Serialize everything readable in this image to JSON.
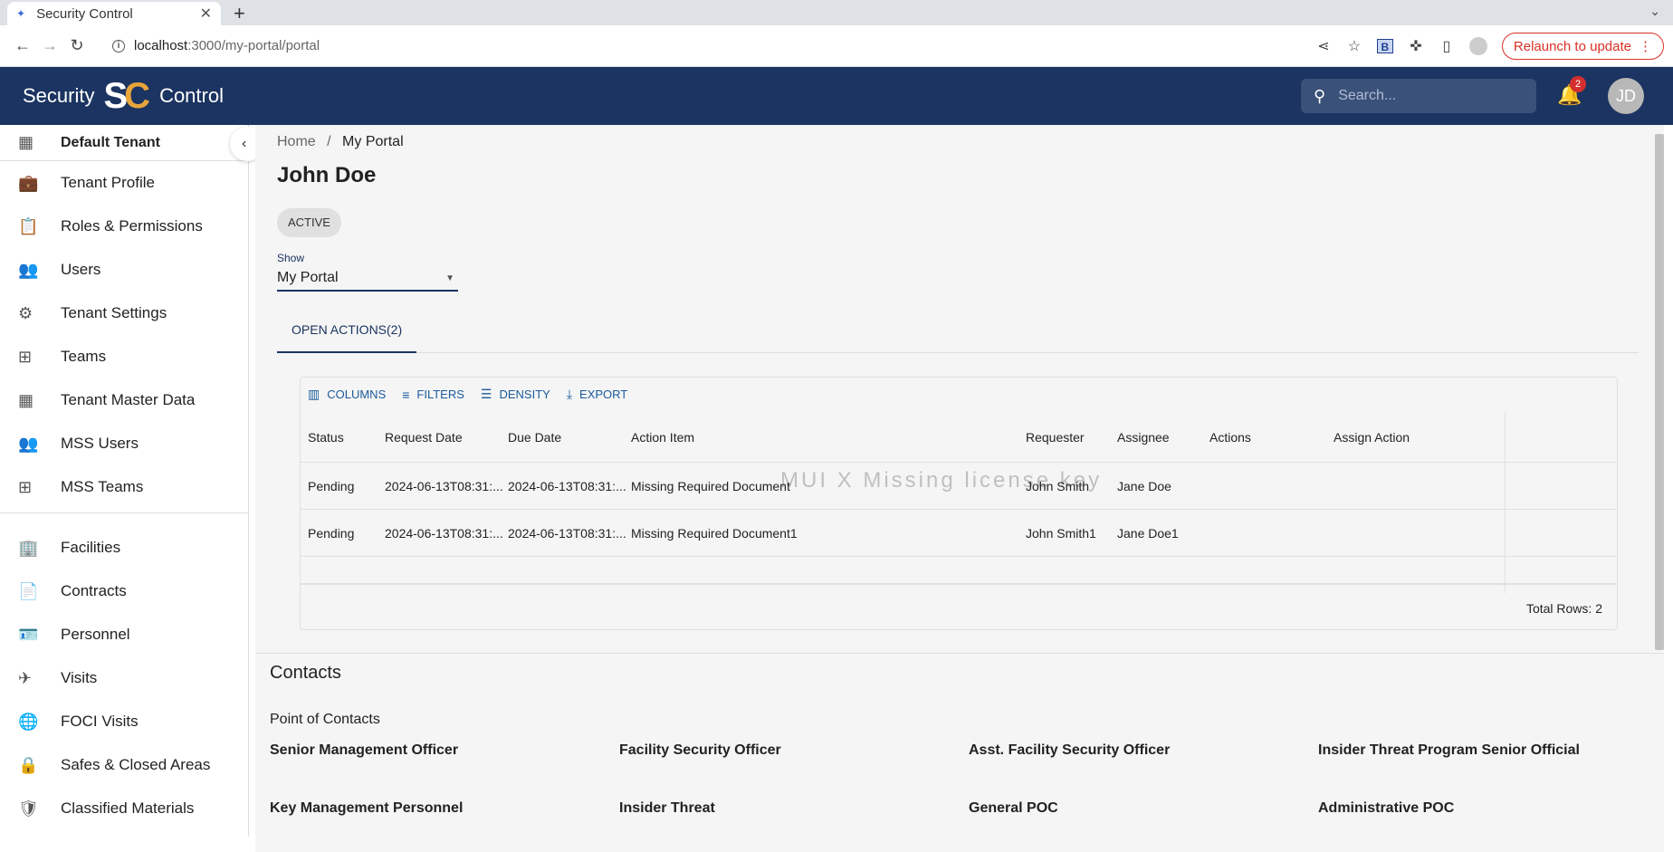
{
  "browser": {
    "tab_title": "Security Control",
    "url_host": "localhost",
    "url_path": ":3000/my-portal/portal",
    "relaunch_label": "Relaunch to update"
  },
  "header": {
    "brand_left": "Security",
    "logo_s": "S",
    "logo_c": "C",
    "brand_right": "Control",
    "search_placeholder": "Search...",
    "notification_count": "2",
    "avatar_initials": "JD"
  },
  "sidebar": {
    "tenant": "Default Tenant",
    "items": [
      {
        "label": "Tenant Profile",
        "icon": "briefcase-icon",
        "glyph": "💼"
      },
      {
        "label": "Roles & Permissions",
        "icon": "clipboard-check-icon",
        "glyph": "📋"
      },
      {
        "label": "Users",
        "icon": "users-icon",
        "glyph": "👥"
      },
      {
        "label": "Tenant Settings",
        "icon": "gear-icon",
        "glyph": "⚙"
      },
      {
        "label": "Teams",
        "icon": "org-chart-icon",
        "glyph": "⊞"
      },
      {
        "label": "Tenant Master Data",
        "icon": "grid-icon",
        "glyph": "▦"
      },
      {
        "label": "MSS Users",
        "icon": "users-icon",
        "glyph": "👥"
      },
      {
        "label": "MSS Teams",
        "icon": "org-chart-icon",
        "glyph": "⊞"
      }
    ],
    "items2": [
      {
        "label": "Facilities",
        "icon": "building-icon",
        "glyph": "🏢"
      },
      {
        "label": "Contracts",
        "icon": "contract-icon",
        "glyph": "📄"
      },
      {
        "label": "Personnel",
        "icon": "id-card-icon",
        "glyph": "🪪"
      },
      {
        "label": "Visits",
        "icon": "airplane-icon",
        "glyph": "✈"
      },
      {
        "label": "FOCI Visits",
        "icon": "globe-icon",
        "glyph": "🌐"
      },
      {
        "label": "Safes & Closed Areas",
        "icon": "lock-icon",
        "glyph": "🔒"
      },
      {
        "label": "Classified Materials",
        "icon": "shield-icon",
        "glyph": "🛡"
      }
    ]
  },
  "main": {
    "breadcrumb_home": "Home",
    "breadcrumb_sep": "/",
    "breadcrumb_current": "My Portal",
    "title": "John Doe",
    "status_chip": "ACTIVE",
    "show_label": "Show",
    "show_value": "My Portal",
    "tab_label": "OPEN ACTIONS(2)",
    "toolbar": {
      "columns": "COLUMNS",
      "filters": "FILTERS",
      "density": "DENSITY",
      "export": "EXPORT"
    },
    "table": {
      "headers": [
        "Status",
        "Request Date",
        "Due Date",
        "Action Item",
        "Requester",
        "Assignee",
        "Actions",
        "Assign Action"
      ],
      "rows": [
        [
          "Pending",
          "2024-06-13T08:31:...",
          "2024-06-13T08:31:...",
          "Missing Required Document",
          "John Smith",
          "Jane Doe"
        ],
        [
          "Pending",
          "2024-06-13T08:31:...",
          "2024-06-13T08:31:...",
          "Missing Required Document1",
          "John Smith1",
          "Jane Doe1"
        ]
      ],
      "total_rows": "Total Rows: 2",
      "watermark": "MUI X Missing license key"
    },
    "contacts": {
      "title": "Contacts",
      "poc_title": "Point of Contacts",
      "roles": [
        "Senior Management Officer",
        "Facility Security Officer",
        "Asst. Facility Security Officer",
        "Insider Threat Program Senior Official",
        "Key Management Personnel",
        "Insider Threat",
        "General POC",
        "Administrative POC"
      ]
    }
  }
}
